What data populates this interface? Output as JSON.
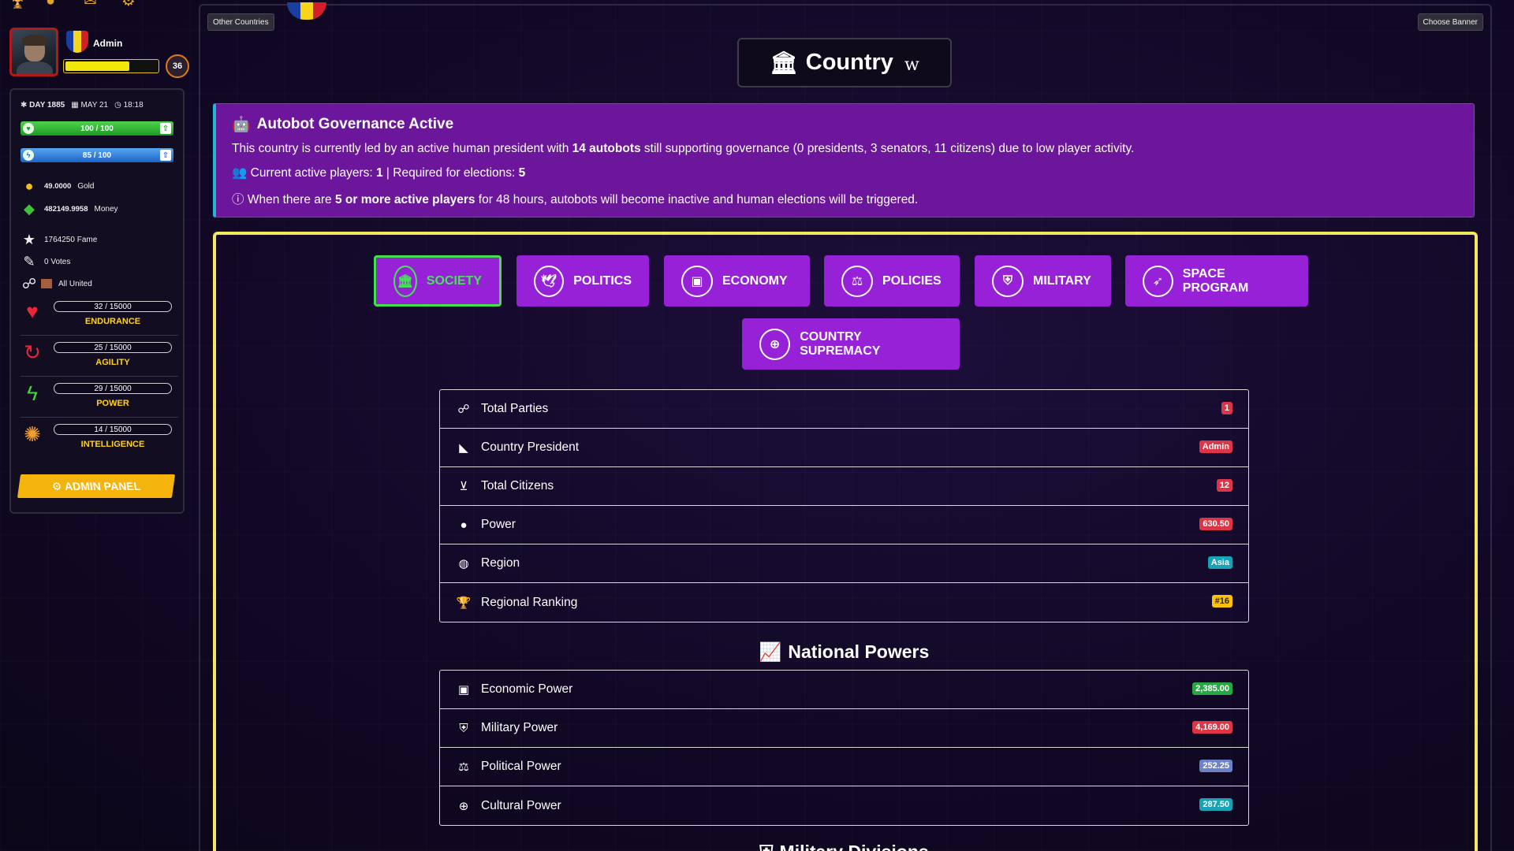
{
  "player": {
    "name": "Admin",
    "level": "36",
    "day": "DAY 1885",
    "date": "MAY 21",
    "time": "18:18",
    "health": "100 / 100",
    "energy": "85 / 100",
    "gold_value": "49.0000",
    "gold_label": "Gold",
    "money_value": "482149.9958",
    "money_label": "Money",
    "fame": "1764250 Fame",
    "votes": "0 Votes",
    "party": "All United",
    "xp_fraction": 0.7
  },
  "attributes": [
    {
      "value": "32 / 15000",
      "label": "ENDURANCE"
    },
    {
      "value": "25 / 15000",
      "label": "AGILITY"
    },
    {
      "value": "29 / 15000",
      "label": "POWER"
    },
    {
      "value": "14 / 15000",
      "label": "INTELLIGENCE"
    }
  ],
  "admin_button": "ADMIN PANEL",
  "top_buttons": {
    "other_countries": "Other Countries",
    "choose_banner": "Choose Banner"
  },
  "country": {
    "title": "Country",
    "subtitle": "w"
  },
  "notice": {
    "title": "Autobot Governance Active",
    "line1_pre": "This country is currently led by an active human president with ",
    "line1_bold": "14 autobots",
    "line1_post": " still supporting governance (0 presidents, 3 senators, 11 citizens) due to low player activity.",
    "line2_pre": "Current active players: ",
    "line2_b1": "1",
    "line2_mid": " | Required for elections: ",
    "line2_b2": "5",
    "line3_pre": "When there are ",
    "line3_bold": "5 or more active players",
    "line3_post": " for 48 hours, autobots will become inactive and human elections will be triggered."
  },
  "tabs": [
    {
      "label": "SOCIETY",
      "icon": "bank-icon",
      "active": true
    },
    {
      "label": "POLITICS",
      "icon": "dove-icon"
    },
    {
      "label": "ECONOMY",
      "icon": "money-icon"
    },
    {
      "label": "POLICIES",
      "icon": "scale-icon"
    },
    {
      "label": "MILITARY",
      "icon": "shield-icon"
    },
    {
      "label": "SPACE PROGRAM",
      "icon": "rocket-icon"
    },
    {
      "label": "COUNTRY SUPREMACY",
      "icon": "globe-icon"
    }
  ],
  "society_rows": [
    {
      "label": "Total Parties",
      "value": "1",
      "icon": "handshake-icon"
    },
    {
      "label": "Country President",
      "value": "Admin",
      "icon": "user-tie-icon"
    },
    {
      "label": "Total Citizens",
      "value": "12",
      "icon": "person-booth-icon"
    },
    {
      "label": "Power",
      "value": "630.50",
      "icon": "power-icon"
    },
    {
      "label": "Region",
      "value": "Asia",
      "icon": "globe-icon"
    },
    {
      "label": "Regional Ranking",
      "value": "#16",
      "icon": "trophy-icon"
    }
  ],
  "national_powers_title": "National Powers",
  "power_rows": [
    {
      "label": "Economic Power",
      "value": "2,385.00",
      "icon": "money-icon"
    },
    {
      "label": "Military Power",
      "value": "4,169.00",
      "icon": "shield-icon"
    },
    {
      "label": "Political Power",
      "value": "252.25",
      "icon": "scale-icon"
    },
    {
      "label": "Cultural Power",
      "value": "287.50",
      "icon": "globe-icon"
    }
  ],
  "military_divisions_title": "Military Divisions",
  "colors": {
    "accent_purple": "#9621d6",
    "active_green": "#43e04e",
    "frame_yellow": "#f2e85f",
    "notice_bg": "#6c169b"
  }
}
